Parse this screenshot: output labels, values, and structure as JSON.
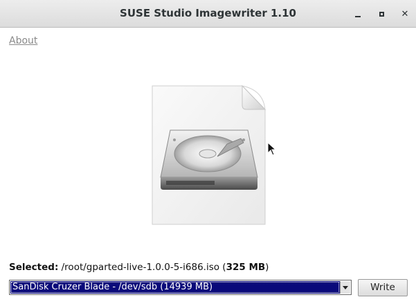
{
  "window": {
    "title": "SUSE Studio Imagewriter 1.10",
    "minimize_icon": "minimize-icon",
    "maximize_icon": "maximize-icon",
    "close_icon": "close-icon",
    "close_glyph": "✕"
  },
  "about": {
    "label": "About"
  },
  "graphic": {
    "icon": "drive-document-icon"
  },
  "selection": {
    "label": "Selected:",
    "path": " /root/gparted-live-1.0.0-5-i686.iso (",
    "size": "325 MB",
    "close_paren": ")"
  },
  "device": {
    "selected": "SanDisk Cruzer Blade - /dev/sdb (14939 MB)"
  },
  "actions": {
    "write_label": "Write"
  },
  "colors": {
    "selection_highlight": "#0a0a7a",
    "titlebar": "#e4e4e4"
  }
}
